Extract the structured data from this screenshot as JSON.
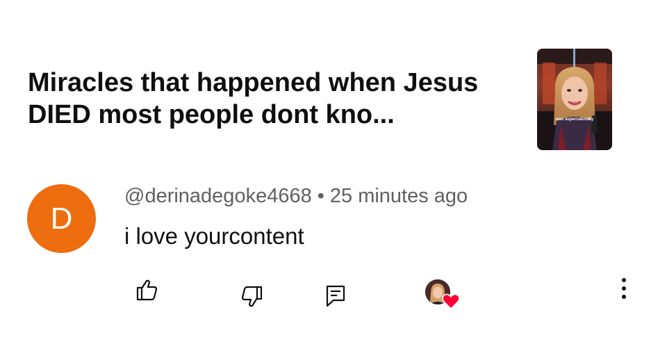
{
  "video": {
    "title": "Miracles that happened when Jesus DIED most people dont kno...",
    "thumbnail_caption": "was supernaturally"
  },
  "comment": {
    "avatar_letter": "D",
    "avatar_color": "#ee6d0e",
    "author": "@derinadegoke4668",
    "separator": "•",
    "timestamp": "25 minutes ago",
    "text": "i love yourcontent"
  },
  "actions": {
    "like_icon": "thumbs-up-icon",
    "dislike_icon": "thumbs-down-icon",
    "reply_icon": "comment-icon",
    "creator_heart_icon": "heart-icon",
    "heart_color": "#ff0033",
    "more_icon": "more-vertical-icon"
  }
}
